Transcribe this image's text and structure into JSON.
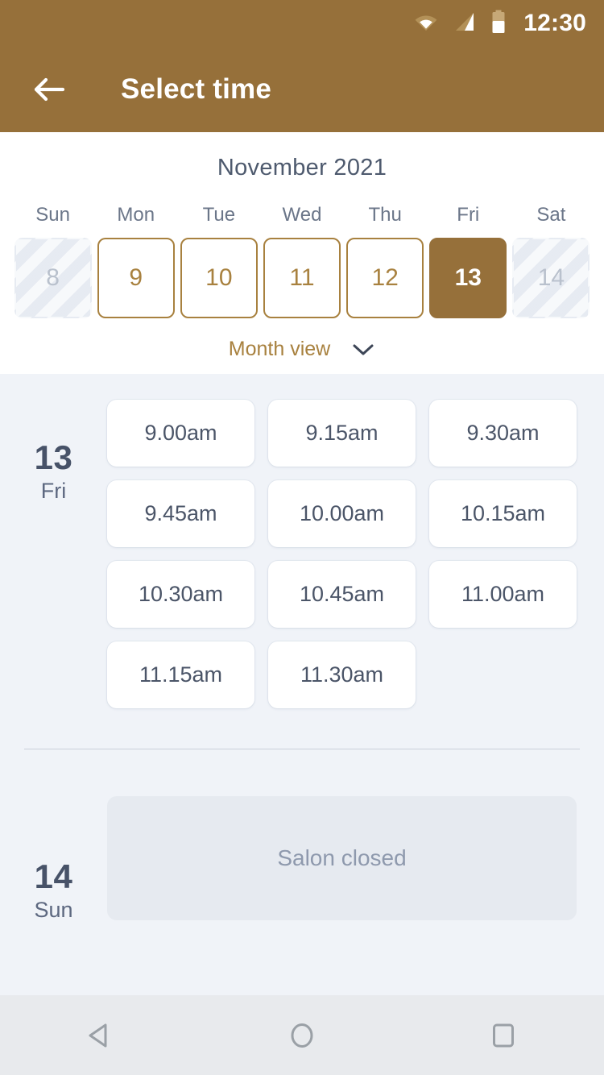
{
  "statusbar": {
    "time": "12:30",
    "icons": [
      "wifi-icon",
      "cell-signal-icon",
      "battery-icon"
    ]
  },
  "appbar": {
    "back_icon": "arrow-left-icon",
    "title": "Select time"
  },
  "calendar": {
    "month_title": "November 2021",
    "day_headers": [
      "Sun",
      "Mon",
      "Tue",
      "Wed",
      "Thu",
      "Fri",
      "Sat"
    ],
    "days": [
      {
        "num": "8",
        "state": "disabled"
      },
      {
        "num": "9",
        "state": "available"
      },
      {
        "num": "10",
        "state": "available"
      },
      {
        "num": "11",
        "state": "available"
      },
      {
        "num": "12",
        "state": "available"
      },
      {
        "num": "13",
        "state": "selected"
      },
      {
        "num": "14",
        "state": "disabled"
      }
    ],
    "view_toggle_label": "Month view",
    "view_toggle_icon": "chevron-down-icon",
    "accent_color": "#96703a",
    "outline_color": "#a8813f"
  },
  "schedule": [
    {
      "day_num": "13",
      "day_dow": "Fri",
      "slots": [
        "9.00am",
        "9.15am",
        "9.30am",
        "9.45am",
        "10.00am",
        "10.15am",
        "10.30am",
        "10.45am",
        "11.00am",
        "11.15am",
        "11.30am"
      ]
    },
    {
      "day_num": "14",
      "day_dow": "Sun",
      "closed_message": "Salon closed"
    }
  ],
  "navbar": {
    "back_icon": "triangle-back-icon",
    "home_icon": "circle-home-icon",
    "recents_icon": "square-recents-icon"
  }
}
